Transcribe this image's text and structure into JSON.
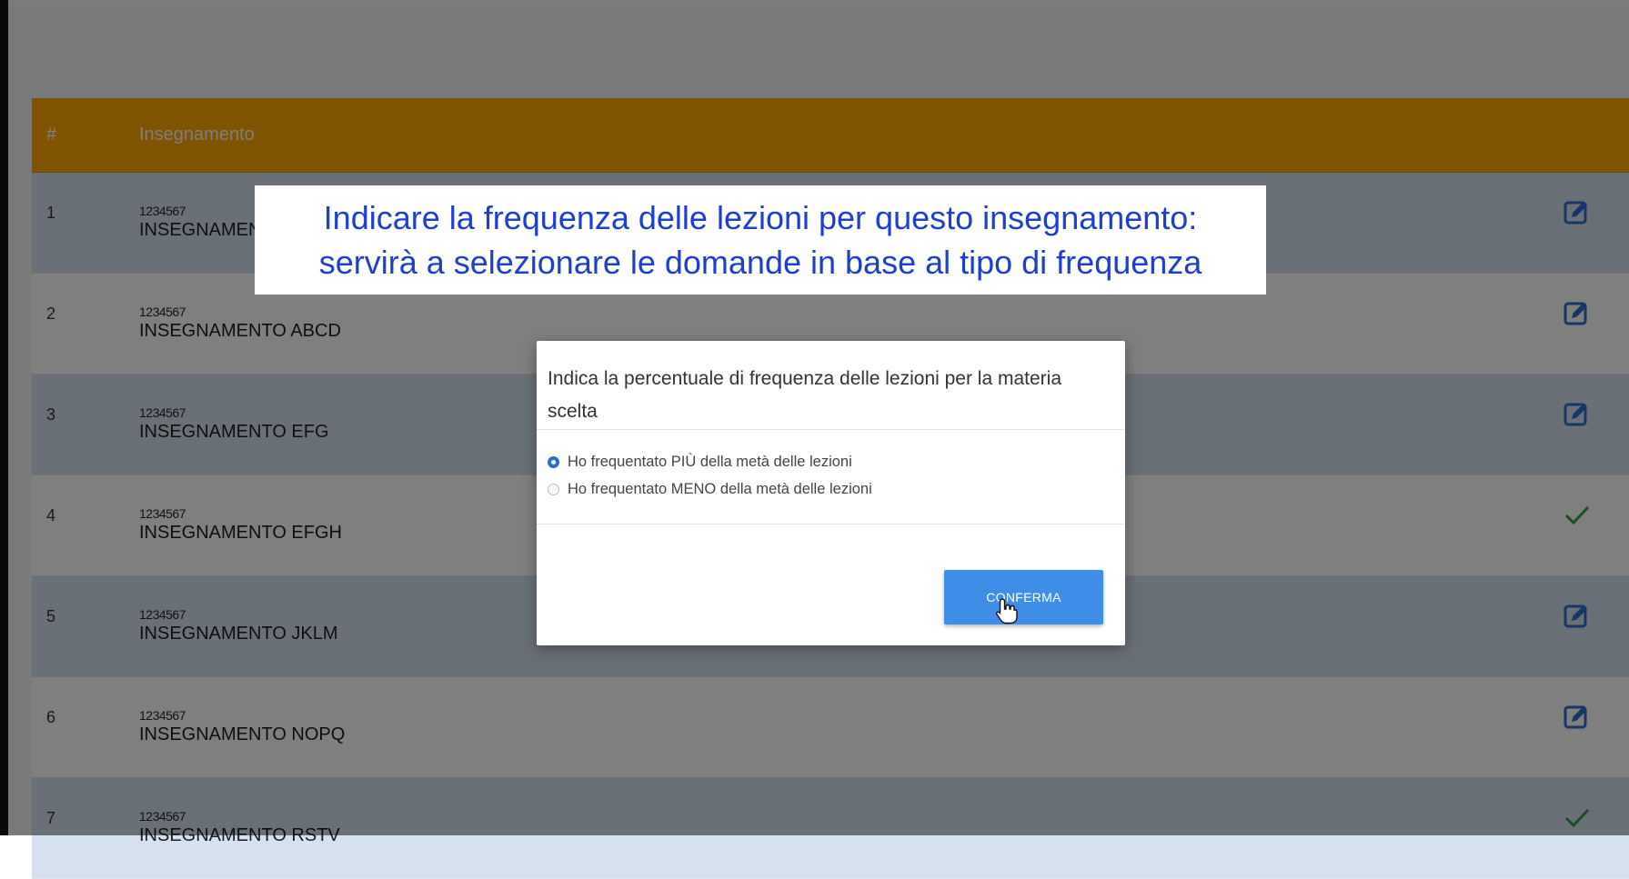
{
  "table": {
    "header_num": "#",
    "header_course": "Insegnamento",
    "rows": [
      {
        "num": "1",
        "code": "1234567",
        "name": "INSEGNAMENTO",
        "action_icon": "edit-icon"
      },
      {
        "num": "2",
        "code": "1234567",
        "name": "INSEGNAMENTO ABCD",
        "action_icon": "edit-icon"
      },
      {
        "num": "3",
        "code": "1234567",
        "name": "INSEGNAMENTO EFG",
        "action_icon": "edit-icon"
      },
      {
        "num": "4",
        "code": "1234567",
        "name": "INSEGNAMENTO EFGH",
        "action_icon": "check-icon"
      },
      {
        "num": "5",
        "code": "1234567",
        "name": "INSEGNAMENTO JKLM",
        "action_icon": "edit-icon"
      },
      {
        "num": "6",
        "code": "1234567",
        "name": "INSEGNAMENTO NOPQ",
        "action_icon": "edit-icon"
      },
      {
        "num": "7",
        "code": "1234567",
        "name": "INSEGNAMENTO RSTV",
        "action_icon": "check-icon"
      }
    ]
  },
  "caption": {
    "line1": "Indicare la frequenza delle lezioni per questo insegnamento:",
    "line2": "servirà a selezionare le domande in base al tipo di frequenza"
  },
  "modal": {
    "title": "Indica la percentuale di frequenza delle lezioni per la materia scelta",
    "options": [
      {
        "label": "Ho frequentato PIÙ della metà delle lezioni",
        "selected": true
      },
      {
        "label": "Ho frequentato MENO della metà delle lezioni",
        "selected": false
      }
    ],
    "confirm_label": "CONFERMA"
  },
  "colors": {
    "header_bg": "#ffa800",
    "row_alt_bg": "#d5e1f0",
    "edit_icon": "#2a6ccc",
    "check_icon": "#2e9e3e",
    "caption_text": "#1d3fcc",
    "confirm_button": "#3f8fe8"
  }
}
